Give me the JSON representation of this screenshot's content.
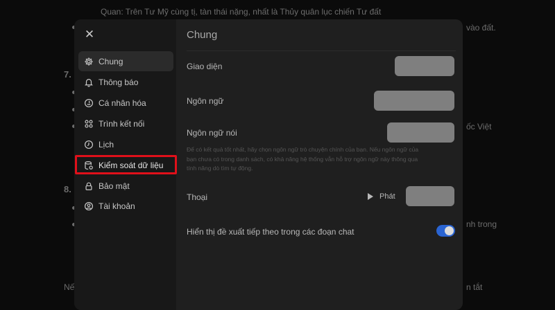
{
  "background": {
    "lines": [
      {
        "text": "Quan: Trên Tư Mỹ cùng tị, tàn thái nặng, nhất là Thủy quân lục chiến Tư đất",
        "name": "bg-line-top"
      },
      {
        "text": "vào đất.",
        "name": "bg-line-right-1"
      },
      {
        "text": "7.",
        "name": "bg-num-7"
      },
      {
        "text": "ốc Việt",
        "name": "bg-line-right-2"
      },
      {
        "text": "8.",
        "name": "bg-num-8"
      },
      {
        "text": "nh trong",
        "name": "bg-line-right-3"
      },
      {
        "text": "Nế",
        "name": "bg-line-left-bottom"
      },
      {
        "text": "n tắt",
        "name": "bg-line-right-4"
      }
    ]
  },
  "modal": {
    "close_icon": "close-icon",
    "sidebar": {
      "items": [
        {
          "label": "Chung",
          "icon": "gear-icon",
          "active": true
        },
        {
          "label": "Thông báo",
          "icon": "bell-icon",
          "active": false
        },
        {
          "label": "Cá nhân hóa",
          "icon": "personalize-icon",
          "active": false
        },
        {
          "label": "Trình kết nối",
          "icon": "connector-icon",
          "active": false
        },
        {
          "label": "Lịch",
          "icon": "clock-icon",
          "active": false
        },
        {
          "label": "Kiểm soát dữ liệu",
          "icon": "database-icon",
          "active": false,
          "highlighted": true
        },
        {
          "label": "Bảo mật",
          "icon": "lock-icon",
          "active": false
        },
        {
          "label": "Tài khoản",
          "icon": "account-icon",
          "active": false
        }
      ],
      "highlight_color": "#e0101a"
    },
    "content": {
      "title": "Chung",
      "rows": {
        "appearance": {
          "label": "Giao diện"
        },
        "language": {
          "label": "Ngôn ngữ"
        },
        "spoken_language": {
          "label": "Ngôn ngữ nói"
        },
        "voice": {
          "label": "Thoại",
          "play_label": "Phát"
        },
        "suggestions": {
          "label": "Hiển thị đề xuất tiếp theo trong các đoạn chat",
          "toggle_on": true
        }
      },
      "help_text": "Để có kết quả tốt nhất, hãy chọn ngôn ngữ trò chuyện chính của bạn. Nếu ngôn ngữ của bạn chưa có trong danh sách, có khả năng hệ thống vẫn hỗ trợ ngôn ngữ này thông qua tính năng dò tìm tự động."
    }
  },
  "colors": {
    "toggle_on": "#2a64d2",
    "placeholder": "#7f7f7f"
  }
}
